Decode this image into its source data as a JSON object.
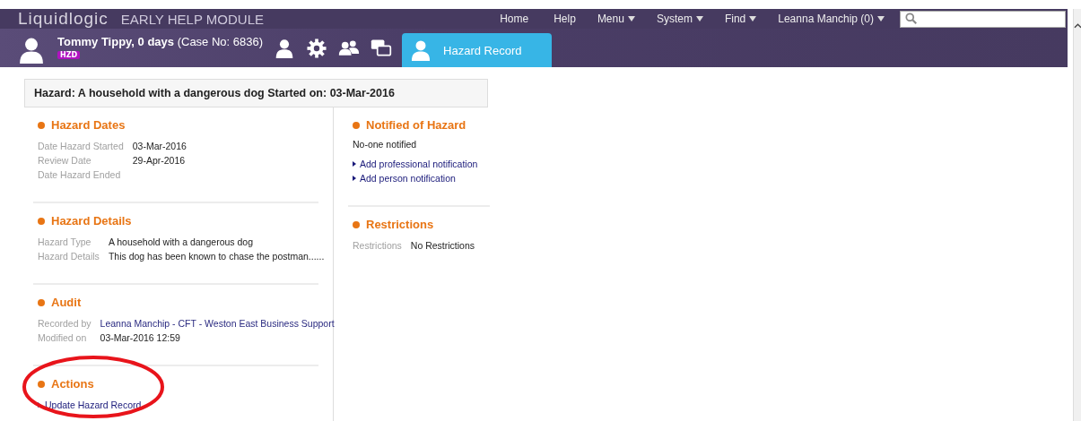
{
  "app": {
    "brand": "Liquidlogic",
    "module": "EARLY HELP MODULE"
  },
  "nav": [
    {
      "label": "Home",
      "dropdown": false
    },
    {
      "label": "Help",
      "dropdown": false
    },
    {
      "label": "Menu",
      "dropdown": true
    },
    {
      "label": "System",
      "dropdown": true
    },
    {
      "label": "Find",
      "dropdown": true
    },
    {
      "label": "Leanna Manchip (0)",
      "dropdown": true
    }
  ],
  "person": {
    "name": "Tommy Tippy, 0 days",
    "case": "(Case No: 6836)",
    "badge": "HZD"
  },
  "tabs": [
    {
      "label": "Hazard Record",
      "selected": true
    }
  ],
  "header": "Hazard: A household with a dangerous dog Started on: 03-Mar-2016",
  "left_sections": [
    {
      "title": "Hazard Dates",
      "fields": [
        {
          "label": "Date Hazard Started",
          "value": "03-Mar-2016"
        },
        {
          "label": "Review Date",
          "value": "29-Apr-2016"
        },
        {
          "label": "Date Hazard Ended"
        }
      ]
    },
    {
      "title": "Hazard Details",
      "fields": [
        {
          "label": "Hazard Type",
          "value": "A household with a dangerous dog"
        },
        {
          "label": "Hazard Details",
          "value": "This dog has been known to chase the postman......"
        }
      ]
    },
    {
      "title": "Audit",
      "fields": [
        {
          "label": "Recorded by",
          "value": "Leanna Manchip - CFT - Weston East Business Support",
          "kind": "link"
        },
        {
          "label": "Modified on",
          "value": "03-Mar-2016 12:59"
        }
      ]
    },
    {
      "title": "Actions",
      "links": [
        "Update Hazard Record"
      ]
    }
  ],
  "right_sections": [
    {
      "title": "Notified of Hazard",
      "text": "No-one notified",
      "links": [
        "Add professional notification",
        "Add person notification"
      ]
    },
    {
      "title": "Restrictions",
      "fields": [
        {
          "label": "Restrictions",
          "value": "No Restrictions"
        }
      ]
    }
  ],
  "annotation": {
    "kind": "ellipse"
  }
}
